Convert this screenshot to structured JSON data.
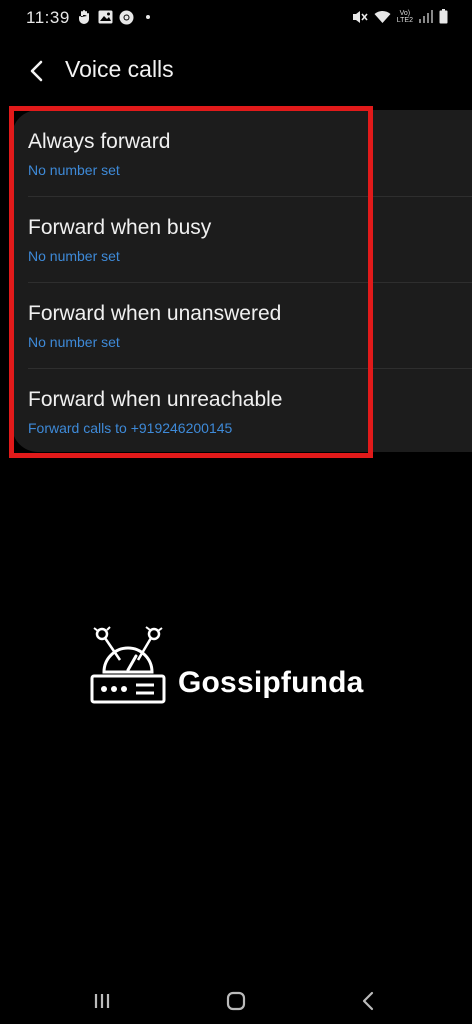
{
  "status_bar": {
    "time": "11:39",
    "volte_top": "Vo)",
    "volte_bottom": "LTE2"
  },
  "header": {
    "title": "Voice calls",
    "back_icon": "chevron-left-icon"
  },
  "forward_options": [
    {
      "title": "Always forward",
      "subtitle": "No number set"
    },
    {
      "title": "Forward when busy",
      "subtitle": "No number set"
    },
    {
      "title": "Forward when unanswered",
      "subtitle": "No number set"
    },
    {
      "title": "Forward when unreachable",
      "subtitle": "Forward calls to +919246200145"
    }
  ],
  "watermark": {
    "text": "Gossipfunda"
  },
  "nav_bar": {
    "recents_icon": "recents-icon",
    "home_icon": "home-icon",
    "back_icon": "back-icon"
  },
  "colors": {
    "background": "#000000",
    "card": "#1c1c1c",
    "subtitle_blue": "#3e8ad8",
    "highlight_red": "#e11a1a"
  }
}
